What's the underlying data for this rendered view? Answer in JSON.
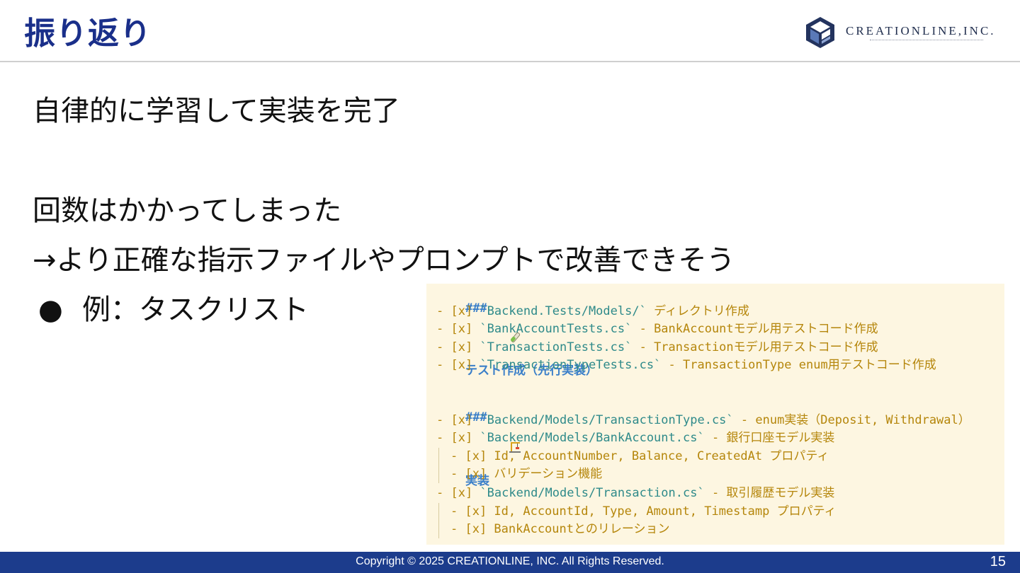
{
  "header": {
    "title": "振り返り",
    "logo_text": "CREATIONLINE,INC.",
    "logo_icon": "creationline-cube-logo-icon"
  },
  "body": {
    "line1": "自律的に学習して実装を完了",
    "line2": "回数はかかってしまった",
    "line3": "→より正確な指示ファイルやプロンプトで改善できそう",
    "bullet": "例：タスクリスト"
  },
  "code": {
    "section1": {
      "hash": "###",
      "icon": "test-tube-icon",
      "title": "テスト作成（先行実装）",
      "items": [
        {
          "prefix": "- [x] ",
          "path": "`Backend.Tests/Models/`",
          "desc": " ディレクトリ作成"
        },
        {
          "prefix": "- [x] ",
          "path": "`BankAccountTests.cs`",
          "desc": " - BankAccountモデル用テストコード作成"
        },
        {
          "prefix": "- [x] ",
          "path": "`TransactionTests.cs`",
          "desc": " - Transactionモデル用テストコード作成"
        },
        {
          "prefix": "- [x] ",
          "path": "`TransactionTypeTests.cs`",
          "desc": " - TransactionType enum用テストコード作成"
        }
      ]
    },
    "section2": {
      "hash": "###",
      "icon": "construction-crane-icon",
      "title": "実装",
      "items": [
        {
          "prefix": "- [x] ",
          "path": "`Backend/Models/TransactionType.cs`",
          "desc": " - enum実装（Deposit, Withdrawal）"
        },
        {
          "prefix": "- [x] ",
          "path": "`Backend/Models/BankAccount.cs`",
          "desc": " - 銀行口座モデル実装"
        },
        {
          "sub": "- [x] Id, AccountNumber, Balance, CreatedAt プロパティ"
        },
        {
          "sub": "- [x] バリデーション機能"
        },
        {
          "prefix": "- [x] ",
          "path": "`Backend/Models/Transaction.cs`",
          "desc": " - 取引履歴モデル実装"
        },
        {
          "sub": "- [x] Id, AccountId, Type, Amount, Timestamp プロパティ"
        },
        {
          "sub": "- [x] BankAccountとのリレーション"
        }
      ]
    }
  },
  "footer": {
    "copyright": "Copyright © 2025 CREATIONLINE, INC. All Rights Reserved.",
    "page_number": "15"
  },
  "colors": {
    "title": "#1a2f8a",
    "footer_bg": "#1c3c8c",
    "code_bg": "#fdf6e1",
    "code_text": "#b5860b",
    "code_heading": "#3a7fc9",
    "code_path": "#2e8a8a"
  }
}
